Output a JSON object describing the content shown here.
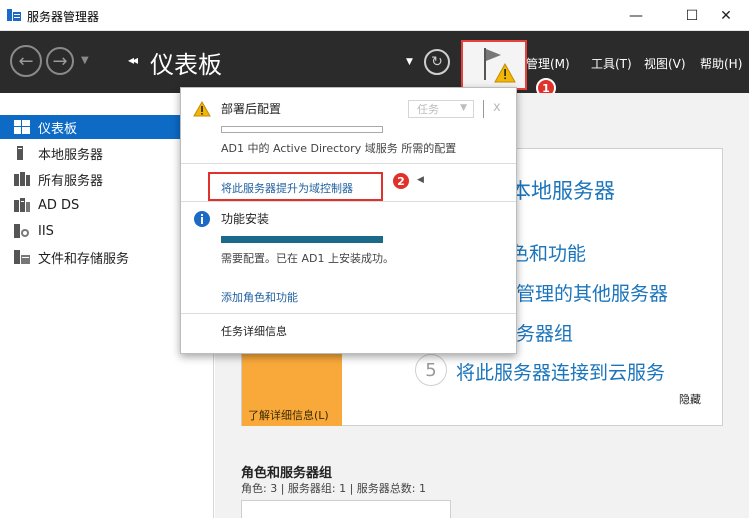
{
  "window": {
    "title": "服务器管理器",
    "minimize": "—",
    "maximize": "☐",
    "close": "✕"
  },
  "header": {
    "page_title": "仪表板",
    "breadcrumb_arrows": "◂◂",
    "menu": {
      "manage": "管理(M)",
      "tools": "工具(T)",
      "view": "视图(V)",
      "help": "帮助(H)"
    }
  },
  "callouts": {
    "first": "1",
    "second": "2"
  },
  "sidebar": {
    "items": [
      {
        "label": "仪表板",
        "icon": "dashboard-icon",
        "active": true
      },
      {
        "label": "本地服务器",
        "icon": "local-server-icon",
        "active": false
      },
      {
        "label": "所有服务器",
        "icon": "all-servers-icon",
        "active": false
      },
      {
        "label": "AD DS",
        "icon": "ad-ds-icon",
        "active": false
      },
      {
        "label": "IIS",
        "icon": "iis-icon",
        "active": false
      },
      {
        "label": "文件和存储服务",
        "icon": "file-storage-icon",
        "active": false
      }
    ]
  },
  "notifications": {
    "deploy": {
      "title": "部署后配置",
      "task_dropdown": "任务",
      "close": "x",
      "description": "AD1 中的 Active Directory 域服务 所需的配置",
      "action_link": "将此服务器提升为域控制器",
      "progress": 0
    },
    "feature": {
      "title": "功能安装",
      "status": "需要配置。已在 AD1 上安装成功。",
      "action_link": "添加角色和功能",
      "progress": 1
    },
    "task_details": "任务详细信息"
  },
  "welcome": {
    "line_local_server": "本地服务器",
    "line_roles": "色和功能",
    "line_manage_others": "管理的其他服务器",
    "line_server_group": "务器组",
    "step_5_number": "5",
    "line_cloud": "将此服务器连接到云服务",
    "learn_more": "了解详细信息(L)",
    "hide": "隐藏"
  },
  "roles_section": {
    "title": "角色和服务器组",
    "summary": "角色: 3 | 服务器组: 1 | 服务器总数: 1"
  },
  "colors": {
    "header_bg": "#2b2b2b",
    "sidebar_active": "#0d6ac5",
    "highlight_red": "#e0312b",
    "link_blue": "#1b75bc",
    "orange": "#f9a93a",
    "progress_teal": "#1b6a8c"
  }
}
